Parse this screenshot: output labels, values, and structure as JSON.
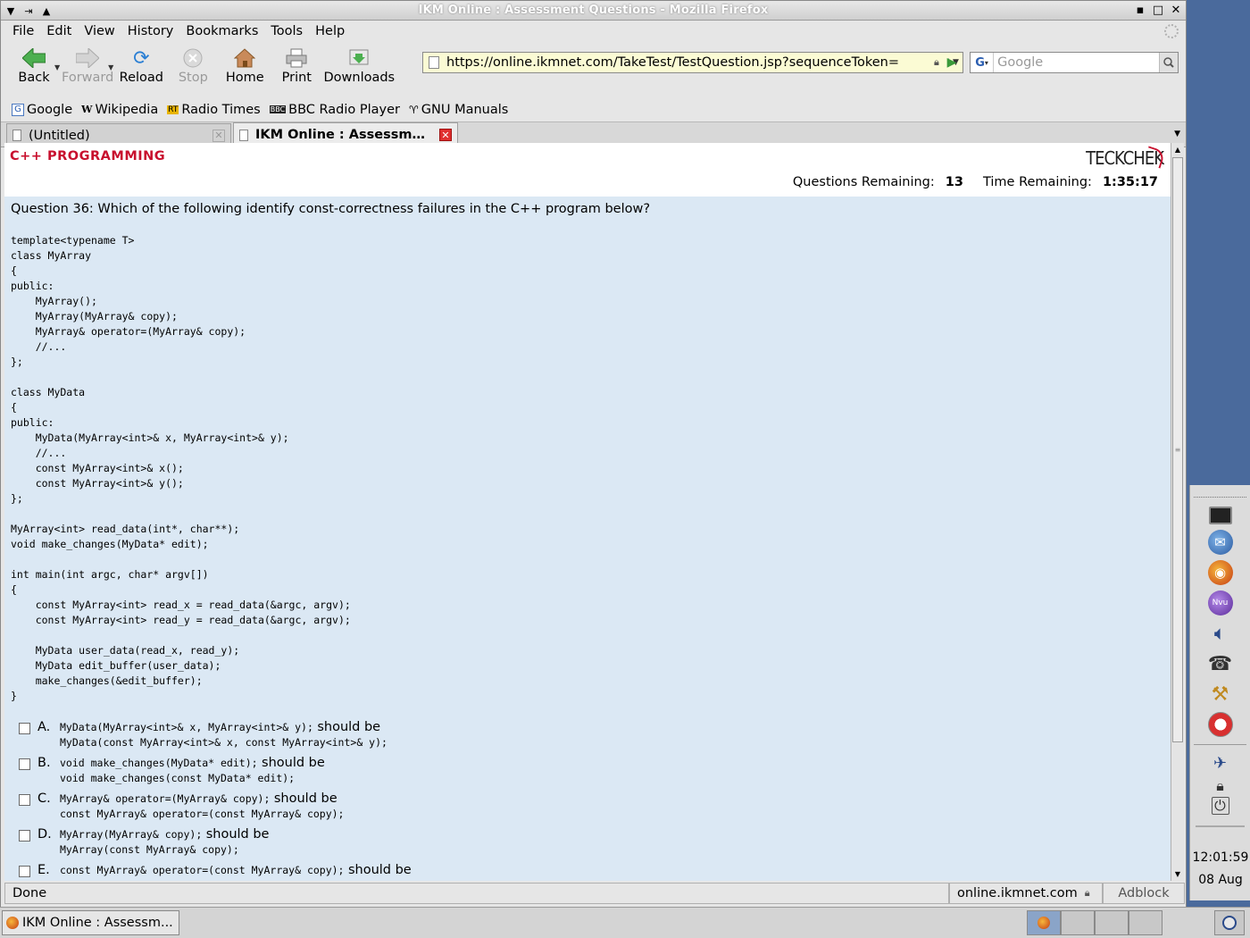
{
  "window": {
    "title": "IKM Online : Assessment Questions - Mozilla Firefox"
  },
  "menu": [
    "File",
    "Edit",
    "View",
    "History",
    "Bookmarks",
    "Tools",
    "Help"
  ],
  "nav": {
    "back": "Back",
    "forward": "Forward",
    "reload": "Reload",
    "stop": "Stop",
    "home": "Home",
    "print": "Print",
    "downloads": "Downloads",
    "url": "https://online.ikmnet.com/TakeTest/TestQuestion.jsp?sequenceToken=",
    "search_placeholder": "Google"
  },
  "bookmarks": [
    "Google",
    "Wikipedia",
    "Radio Times",
    "BBC Radio Player",
    "GNU Manuals"
  ],
  "tabs": [
    "(Untitled)",
    "IKM Online : Assessme..."
  ],
  "page": {
    "section": "C++ PROGRAMMING",
    "logo": "TECKCHEK",
    "questions_remaining_label": "Questions Remaining:",
    "questions_remaining": "13",
    "time_remaining_label": "Time Remaining:",
    "time_remaining": "1:35:17",
    "question": "Question 36: Which of the following identify const-correctness failures in the C++ program below?",
    "code": "template<typename T>\nclass MyArray\n{\npublic:\n    MyArray();\n    MyArray(MyArray& copy);\n    MyArray& operator=(MyArray& copy);\n    //...\n};\n\nclass MyData\n{\npublic:\n    MyData(MyArray<int>& x, MyArray<int>& y);\n    //...\n    const MyArray<int>& x();\n    const MyArray<int>& y();\n};\n\nMyArray<int> read_data(int*, char**);\nvoid make_changes(MyData* edit);\n\nint main(int argc, char* argv[])\n{\n    const MyArray<int> read_x = read_data(&argc, argv);\n    const MyArray<int> read_y = read_data(&argc, argv);\n\n    MyData user_data(read_x, read_y);\n    MyData edit_buffer(user_data);\n    make_changes(&edit_buffer);\n}",
    "should_be": "should be",
    "answers": [
      {
        "letter": "A.",
        "code1": "MyData(MyArray<int>& x, MyArray<int>& y);",
        "code2": "MyData(const MyArray<int>& x, const MyArray<int>& y);"
      },
      {
        "letter": "B.",
        "code1": "void make_changes(MyData* edit);",
        "code2": "void make_changes(const MyData* edit);"
      },
      {
        "letter": "C.",
        "code1": "MyArray& operator=(MyArray& copy);",
        "code2": "const MyArray& operator=(const MyArray& copy);"
      },
      {
        "letter": "D.",
        "code1": "MyArray(MyArray& copy);",
        "code2": "MyArray(const MyArray& copy);"
      },
      {
        "letter": "E.",
        "code1": "const MyArray& operator=(const MyArray& copy);",
        "code2": ""
      }
    ]
  },
  "status": {
    "text": "Done",
    "host": "online.ikmnet.com",
    "adblock": "Adblock"
  },
  "clock": {
    "time": "12:01:59",
    "date": "08 Aug"
  },
  "taskbar": {
    "task": "IKM Online : Assessm..."
  }
}
